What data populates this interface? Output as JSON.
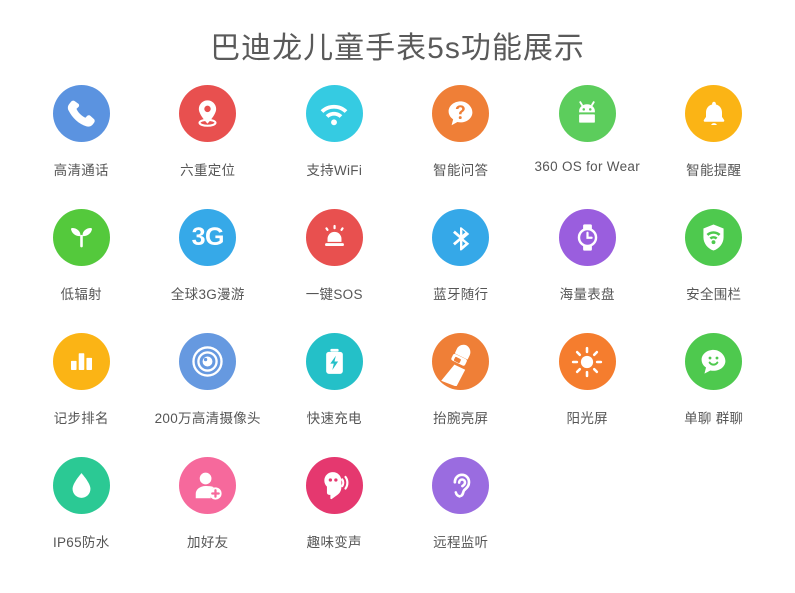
{
  "page": {
    "title": "巴迪龙儿童手表5s功能展示",
    "background_color": "#ffffff",
    "title_color": "#5a5a5a",
    "label_color": "#565656"
  },
  "features": [
    {
      "label": "高清通话",
      "icon": "phone-icon",
      "color": "#5b93e0"
    },
    {
      "label": "六重定位",
      "icon": "location-pin-icon",
      "color": "#e8504f"
    },
    {
      "label": "支持WiFi",
      "icon": "wifi-icon",
      "color": "#35cbe2"
    },
    {
      "label": "智能问答",
      "icon": "question-bubble-icon",
      "color": "#ef7f37"
    },
    {
      "label": "360 OS for Wear",
      "icon": "android-robot-icon",
      "color": "#5ccd5c"
    },
    {
      "label": "智能提醒",
      "icon": "bell-icon",
      "color": "#fbb415"
    },
    {
      "label": "低辐射",
      "icon": "sprout-icon",
      "color": "#54c93c"
    },
    {
      "label": "全球3G漫游",
      "icon": "3g-text-icon",
      "color": "#36a9e8",
      "text": "3G"
    },
    {
      "label": "一键SOS",
      "icon": "alarm-siren-icon",
      "color": "#e8504f"
    },
    {
      "label": "蓝牙随行",
      "icon": "bluetooth-icon",
      "color": "#35a8e8"
    },
    {
      "label": "海量表盘",
      "icon": "watch-face-icon",
      "color": "#9a5ede"
    },
    {
      "label": "安全围栏",
      "icon": "shield-wifi-icon",
      "color": "#4ec94e"
    },
    {
      "label": "记步排名",
      "icon": "bar-chart-icon",
      "color": "#fbb415"
    },
    {
      "label": "200万高清摄像头",
      "icon": "camera-lens-icon",
      "color": "#6699e0"
    },
    {
      "label": "快速充电",
      "icon": "battery-charge-icon",
      "color": "#24c0c8"
    },
    {
      "label": "抬腕亮屏",
      "icon": "raise-wrist-icon",
      "color": "#ef7f37"
    },
    {
      "label": "阳光屏",
      "icon": "sun-icon",
      "color": "#f57d2e"
    },
    {
      "label": "单聊 群聊",
      "icon": "chat-smiley-icon",
      "color": "#4ec94e"
    },
    {
      "label": "IP65防水",
      "icon": "water-drop-icon",
      "color": "#2bc994"
    },
    {
      "label": "加好友",
      "icon": "add-friend-icon",
      "color": "#f6699c"
    },
    {
      "label": "趣味变声",
      "icon": "voice-change-icon",
      "color": "#e5386f"
    },
    {
      "label": "远程监听",
      "icon": "ear-listen-icon",
      "color": "#9a6ce0"
    }
  ]
}
